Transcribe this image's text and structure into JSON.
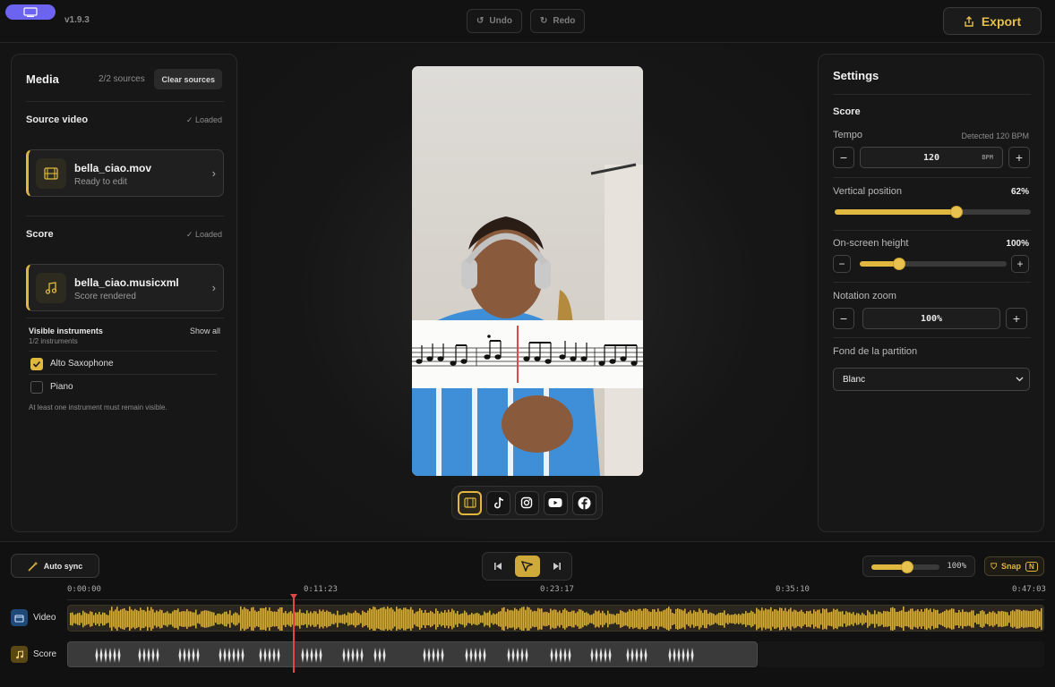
{
  "app": {
    "version": "v1.9.3",
    "undo_label": "Undo",
    "redo_label": "Redo",
    "export_label": "Export"
  },
  "media": {
    "title": "Media",
    "sources_count": "2/2 sources",
    "clear_label": "Clear sources",
    "source_video": {
      "heading": "Source video",
      "status": "✓ Loaded",
      "file_name": "bella_ciao.mov",
      "file_status": "Ready to edit"
    },
    "score": {
      "heading": "Score",
      "status": "✓ Loaded",
      "file_name": "bella_ciao.musicxml",
      "file_status": "Score rendered"
    },
    "instruments": {
      "heading": "Visible instruments",
      "count": "1/2 instruments",
      "show_all": "Show all",
      "items": [
        {
          "label": "Alto Saxophone",
          "checked": true
        },
        {
          "label": "Piano",
          "checked": false
        }
      ],
      "note": "At least one instrument must remain visible."
    }
  },
  "settings": {
    "title": "Settings",
    "section": "Score",
    "tempo": {
      "label": "Tempo",
      "detected": "Detected 120 BPM",
      "value": "120",
      "unit": "BPM"
    },
    "vertical_position": {
      "label": "Vertical position",
      "value": "62%",
      "level": 0.62
    },
    "onscreen_height": {
      "label": "On-screen height",
      "value": "100%",
      "level": 0.27
    },
    "notation_zoom": {
      "label": "Notation zoom",
      "value": "100%"
    },
    "background": {
      "label": "Fond de la partition",
      "selected": "Blanc"
    }
  },
  "timeline": {
    "auto_sync_label": "Auto sync",
    "zoom_value": "100%",
    "snap_label": "Snap",
    "snap_key": "N",
    "timecodes": [
      "0:00:00",
      "0:11:23",
      "0:23:17",
      "0:35:10",
      "0:47:03"
    ],
    "tracks": [
      {
        "label": "Video"
      },
      {
        "label": "Score"
      }
    ]
  },
  "platforms": [
    "film-icon",
    "tiktok-icon",
    "instagram-icon",
    "youtube-icon",
    "facebook-icon"
  ],
  "colors": {
    "accent": "#e0b83f",
    "brand": "#6c63f0",
    "playhead": "#e04848"
  }
}
